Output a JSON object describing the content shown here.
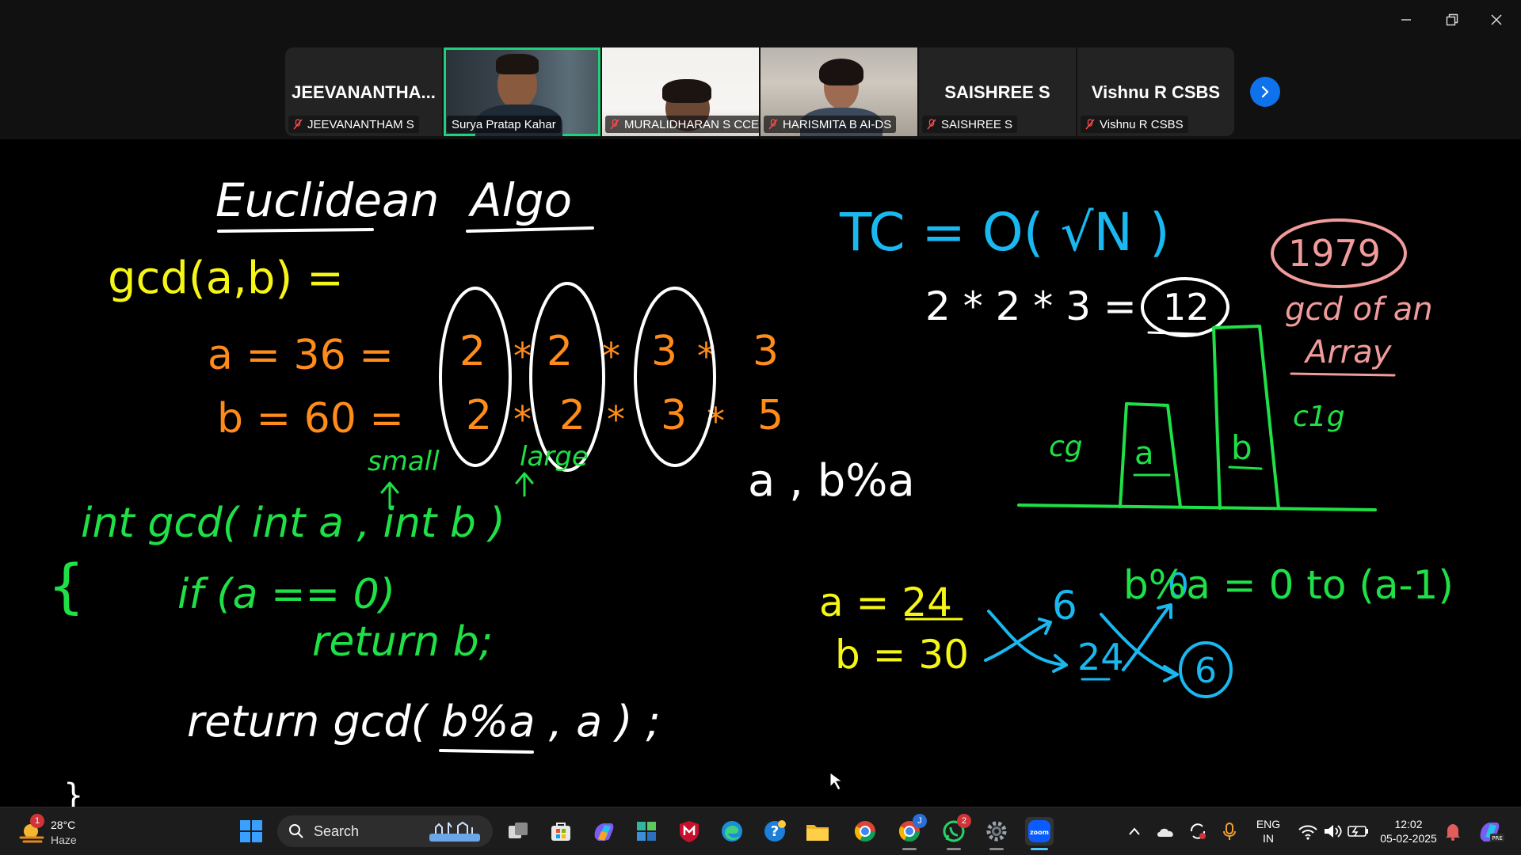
{
  "window": {
    "controls": [
      "minimize-icon",
      "restore-icon",
      "close-icon"
    ]
  },
  "participants": [
    {
      "big_name": "JEEVANANTHA...",
      "label": "JEEVANANTHAM S",
      "muted": true,
      "video": false
    },
    {
      "big_name": "",
      "label": "Surya Pratap Kahar",
      "muted": false,
      "video": true,
      "active_speaker": true
    },
    {
      "big_name": "",
      "label": "MURALIDHARAN S CCE",
      "muted": true,
      "video": true
    },
    {
      "big_name": "",
      "label": "HARISMITA B AI-DS",
      "muted": true,
      "video": true
    },
    {
      "big_name": "SAISHREE S",
      "label": "SAISHREE S",
      "muted": true,
      "video": false
    },
    {
      "big_name": "Vishnu R CSBS",
      "label": "Vishnu R CSBS",
      "muted": true,
      "video": false
    }
  ],
  "whiteboard": {
    "title_1": "Euclidean",
    "title_2": "Algo",
    "gcd_def": "gcd(a,b) =",
    "a_line": {
      "lhs": "a = 36 =",
      "factors": [
        "2",
        "2",
        "3",
        "3"
      ]
    },
    "b_line": {
      "lhs": "b = 60 =",
      "factors": [
        "2",
        "2",
        "3",
        "5"
      ]
    },
    "star": "*",
    "note_small": "small",
    "note_large": "large",
    "code_sig": "int gcd( int a , int b )",
    "code_brace": "{",
    "code_if": "if (a == 0)",
    "code_ret_b": "return b;",
    "code_ret_rec": "return gcd( b%a , a ) ;",
    "code_close": "}",
    "tc": "TC = O( √N )",
    "product": "2 * 2 * 3 =",
    "product_result": "12",
    "recursion": "a , b%a",
    "bar_a": "a",
    "bar_b": "b",
    "cg_left": "cg",
    "cg_right": "c1g",
    "problem_num": "1979",
    "problem_title_1": "gcd of an",
    "problem_title_2": "Array",
    "ex_a": "a = 24",
    "ex_b": "b = 30",
    "ex_6": "6",
    "ex_24": "24",
    "ex_0": "0",
    "ex_6_circled": "6",
    "mod_range": "b%a = 0 to (a-1)",
    "colors": {
      "yellow": "#f5f516",
      "orange": "#ff8c1a",
      "green": "#1fe046",
      "cyan": "#1ab8f0",
      "pink": "#f29b9b",
      "white": "#ffffff"
    }
  },
  "taskbar": {
    "weather_temp": "28°C",
    "weather_desc": "Haze",
    "weather_badge": "1",
    "search_label": "Search",
    "pinned_icons": [
      "start-icon",
      "search-icon",
      "task-view-icon",
      "store-icon",
      "copilot-icon",
      "app-grid-icon",
      "mcafee-icon",
      "edge-icon",
      "help-icon",
      "file-explorer-icon",
      "chrome-icon",
      "chrome-profile-icon",
      "whatsapp-icon",
      "settings-icon",
      "zoom-icon"
    ],
    "chrome_profile_badge": "J",
    "whatsapp_badge": "2",
    "lang_1": "ENG",
    "lang_2": "IN",
    "time": "12:02",
    "date": "05-02-2025"
  }
}
